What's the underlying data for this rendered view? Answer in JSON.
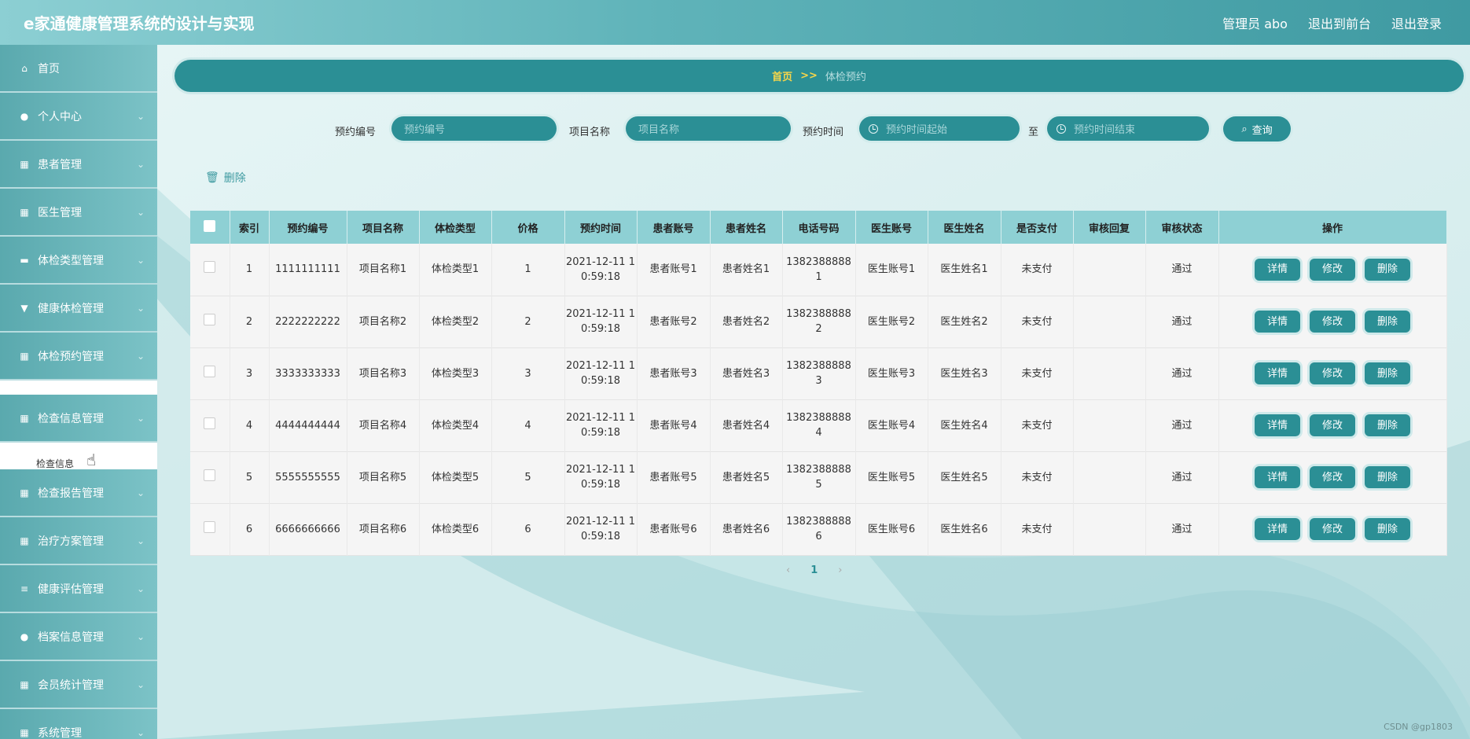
{
  "header": {
    "title": "e家通健康管理系统的设计与实现",
    "admin": "管理员 abo",
    "back_front": "退出到前台",
    "logout": "退出登录"
  },
  "sidebar": {
    "items": [
      {
        "label": "首页",
        "icon": "home-icon",
        "chevron": false
      },
      {
        "label": "个人中心",
        "icon": "user-icon",
        "chevron": true
      },
      {
        "label": "患者管理",
        "icon": "grid-icon",
        "chevron": true
      },
      {
        "label": "医生管理",
        "icon": "grid-icon",
        "chevron": true
      },
      {
        "label": "体检类型管理",
        "icon": "ticket-icon",
        "chevron": true
      },
      {
        "label": "健康体检管理",
        "icon": "trophy-icon",
        "chevron": true
      },
      {
        "label": "体检预约管理",
        "icon": "table-icon",
        "chevron": true
      },
      {
        "label": "检查信息管理",
        "icon": "grid-icon",
        "chevron": true
      },
      {
        "label": "检查报告管理",
        "icon": "grid-icon",
        "chevron": true
      },
      {
        "label": "治疗方案管理",
        "icon": "grid-icon",
        "chevron": true
      },
      {
        "label": "健康评估管理",
        "icon": "list-icon",
        "chevron": true
      },
      {
        "label": "档案信息管理",
        "icon": "user-icon",
        "chevron": true
      },
      {
        "label": "会员统计管理",
        "icon": "grid-icon",
        "chevron": true
      },
      {
        "label": "系统管理",
        "icon": "grid-icon",
        "chevron": true
      }
    ],
    "sub_exam_info": "检查信息"
  },
  "breadcrumb": {
    "home": "首页",
    "sep": ">>",
    "current": "体检预约"
  },
  "search": {
    "label_no": "预约编号",
    "ph_no": "预约编号",
    "label_name": "项目名称",
    "ph_name": "项目名称",
    "label_time": "预约时间",
    "ph_start": "预约时间起始",
    "to": "至",
    "ph_end": "预约时间结束",
    "query": "查询"
  },
  "toolbar": {
    "delete": "删除"
  },
  "table": {
    "headers": [
      "索引",
      "预约编号",
      "项目名称",
      "体检类型",
      "价格",
      "预约时间",
      "患者账号",
      "患者姓名",
      "电话号码",
      "医生账号",
      "医生姓名",
      "是否支付",
      "审核回复",
      "审核状态",
      "操作"
    ],
    "rows": [
      {
        "idx": "1",
        "no": "1111111111",
        "name": "项目名称1",
        "type": "体检类型1",
        "price": "1",
        "time": "2021-12-11 10:59:18",
        "pacc": "患者账号1",
        "pname": "患者姓名1",
        "phone": "13823888881",
        "dacc": "医生账号1",
        "dname": "医生姓名1",
        "paid": "未支付",
        "reply": "",
        "status": "通过"
      },
      {
        "idx": "2",
        "no": "2222222222",
        "name": "项目名称2",
        "type": "体检类型2",
        "price": "2",
        "time": "2021-12-11 10:59:18",
        "pacc": "患者账号2",
        "pname": "患者姓名2",
        "phone": "13823888882",
        "dacc": "医生账号2",
        "dname": "医生姓名2",
        "paid": "未支付",
        "reply": "",
        "status": "通过"
      },
      {
        "idx": "3",
        "no": "3333333333",
        "name": "项目名称3",
        "type": "体检类型3",
        "price": "3",
        "time": "2021-12-11 10:59:18",
        "pacc": "患者账号3",
        "pname": "患者姓名3",
        "phone": "13823888883",
        "dacc": "医生账号3",
        "dname": "医生姓名3",
        "paid": "未支付",
        "reply": "",
        "status": "通过"
      },
      {
        "idx": "4",
        "no": "4444444444",
        "name": "项目名称4",
        "type": "体检类型4",
        "price": "4",
        "time": "2021-12-11 10:59:18",
        "pacc": "患者账号4",
        "pname": "患者姓名4",
        "phone": "13823888884",
        "dacc": "医生账号4",
        "dname": "医生姓名4",
        "paid": "未支付",
        "reply": "",
        "status": "通过"
      },
      {
        "idx": "5",
        "no": "5555555555",
        "name": "项目名称5",
        "type": "体检类型5",
        "price": "5",
        "time": "2021-12-11 10:59:18",
        "pacc": "患者账号5",
        "pname": "患者姓名5",
        "phone": "13823888885",
        "dacc": "医生账号5",
        "dname": "医生姓名5",
        "paid": "未支付",
        "reply": "",
        "status": "通过"
      },
      {
        "idx": "6",
        "no": "6666666666",
        "name": "项目名称6",
        "type": "体检类型6",
        "price": "6",
        "time": "2021-12-11 10:59:18",
        "pacc": "患者账号6",
        "pname": "患者姓名6",
        "phone": "13823888886",
        "dacc": "医生账号6",
        "dname": "医生姓名6",
        "paid": "未支付",
        "reply": "",
        "status": "通过"
      }
    ],
    "op_detail": "详情",
    "op_edit": "修改",
    "op_delete": "删除"
  },
  "pager": {
    "prev": "‹",
    "page": "1",
    "next": "›"
  },
  "watermark": "CSDN @gp1803"
}
